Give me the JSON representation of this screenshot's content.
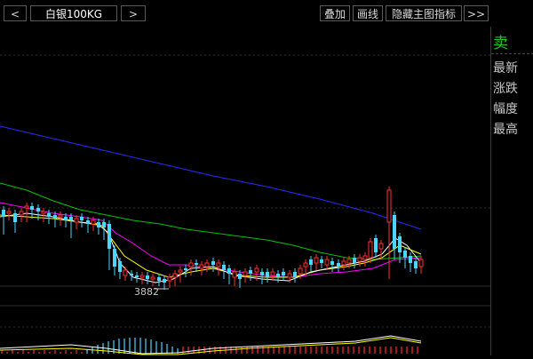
{
  "toolbar": {
    "prev_label": "<",
    "symbol": "白银100KG",
    "next_label": ">",
    "overlay_label": "叠加",
    "draw_label": "画线",
    "hide_indicator_label": "隐藏主图指标",
    "more_label": ">>"
  },
  "sidepanel": {
    "sell_label": "卖",
    "items": [
      "最新",
      "涨跌",
      "幅度",
      "最高"
    ]
  },
  "chart": {
    "low_annotation": "3882",
    "colors": {
      "up": "#ff3030",
      "down": "#49d6ff",
      "ma_short": "#ffffff",
      "ma_mid": "#ffff00",
      "ma_long": "#ff00ff",
      "ma_60": "#00cc00",
      "ma_120": "#2020ff"
    }
  }
}
